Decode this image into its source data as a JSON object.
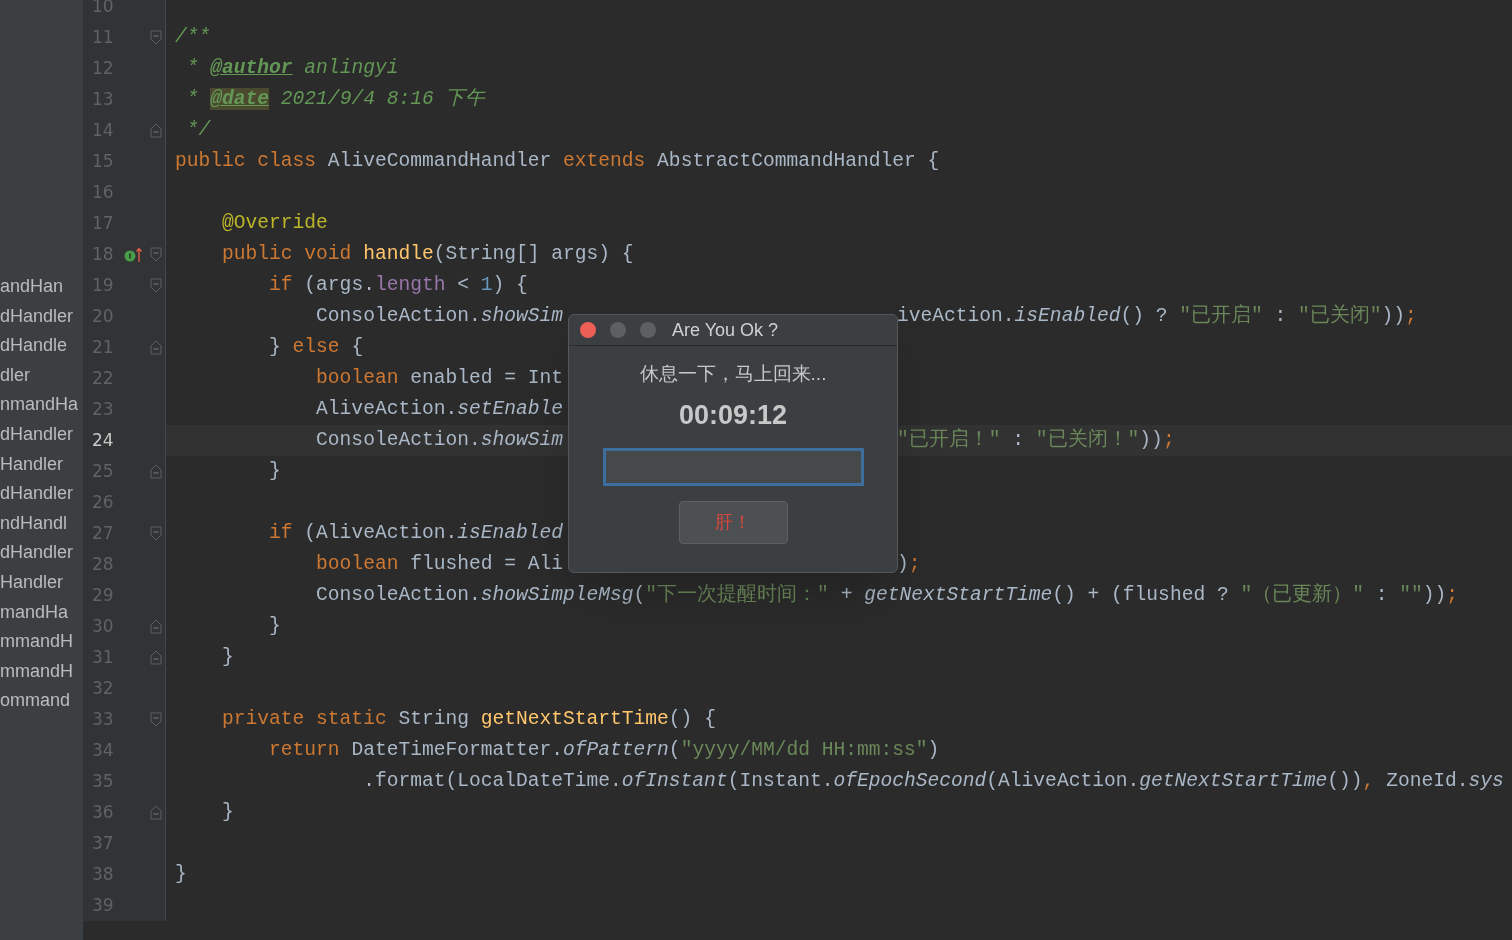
{
  "project_tree": {
    "items": [
      {
        "label": "andHan"
      },
      {
        "label": "dHandler"
      },
      {
        "label": "dHandle"
      },
      {
        "label": "dler"
      },
      {
        "label": "nmandHa"
      },
      {
        "label": "dHandler"
      },
      {
        "label": "Handler"
      },
      {
        "label": "dHandler"
      },
      {
        "label": "ndHandl"
      },
      {
        "label": "dHandler"
      },
      {
        "label": "Handler"
      },
      {
        "label": "mandHa"
      },
      {
        "label": "mmandH"
      },
      {
        "label": "mmandH"
      },
      {
        "label": "ommand"
      }
    ]
  },
  "editor": {
    "lines": [
      {
        "number": "10",
        "current": false,
        "fold_start": false,
        "fold_end": false,
        "marker": false
      },
      {
        "number": "11",
        "current": false,
        "fold_start": true,
        "fold_end": false,
        "marker": false,
        "tokens": [
          {
            "kind": "doc",
            "text": "/**"
          }
        ]
      },
      {
        "number": "12",
        "current": false,
        "fold_start": false,
        "fold_end": false,
        "marker": false,
        "tokens": [
          {
            "kind": "doc",
            "text": " * "
          },
          {
            "kind": "doctag",
            "text": "@author"
          },
          {
            "kind": "doc",
            "text": " anlingyi"
          }
        ]
      },
      {
        "number": "13",
        "current": false,
        "fold_start": false,
        "fold_end": false,
        "marker": false,
        "tokens": [
          {
            "kind": "doc",
            "text": " * "
          },
          {
            "kind": "doctag_match",
            "text": "@date"
          },
          {
            "kind": "doc",
            "text": " 2021/9/4 8:16 下午"
          }
        ]
      },
      {
        "number": "14",
        "current": false,
        "fold_start": false,
        "fold_end": true,
        "marker": false,
        "tokens": [
          {
            "kind": "doc",
            "text": " */"
          }
        ]
      },
      {
        "number": "15",
        "current": false,
        "fold_start": false,
        "fold_end": false,
        "marker": false,
        "tokens": [
          {
            "kind": "kw",
            "text": "public class "
          },
          {
            "kind": "plain",
            "text": "AliveCommandHandler "
          },
          {
            "kind": "kw",
            "text": "extends "
          },
          {
            "kind": "plain",
            "text": "AbstractCommandHandler {"
          }
        ]
      },
      {
        "number": "16",
        "current": false,
        "fold_start": false,
        "fold_end": false,
        "marker": false
      },
      {
        "number": "17",
        "current": false,
        "fold_start": false,
        "fold_end": false,
        "marker": false,
        "tokens": [
          {
            "kind": "anno",
            "text": "    @Override"
          }
        ]
      },
      {
        "number": "18",
        "current": false,
        "fold_start": true,
        "fold_end": false,
        "marker": true,
        "tokens": [
          {
            "kind": "kw",
            "text": "    public void "
          },
          {
            "kind": "decl",
            "text": "handle"
          },
          {
            "kind": "plain",
            "text": "(String[] args) {"
          }
        ]
      },
      {
        "number": "19",
        "current": false,
        "fold_start": true,
        "fold_end": false,
        "marker": false,
        "tokens": [
          {
            "kind": "kw",
            "text": "        if "
          },
          {
            "kind": "plain",
            "text": "(args."
          },
          {
            "kind": "field",
            "text": "length"
          },
          {
            "kind": "plain",
            "text": " < "
          },
          {
            "kind": "num",
            "text": "1"
          },
          {
            "kind": "plain",
            "text": ") {"
          }
        ]
      },
      {
        "number": "20",
        "current": false,
        "fold_start": false,
        "fold_end": false,
        "marker": false,
        "tokens": [
          {
            "kind": "plain",
            "text": "            ConsoleAction."
          },
          {
            "kind": "call",
            "text": "showSim"
          }
        ],
        "after": [
          {
            "kind": "plain",
            "text": "iveAction."
          },
          {
            "kind": "call",
            "text": "isEnabled"
          },
          {
            "kind": "plain",
            "text": "() ? "
          },
          {
            "kind": "str",
            "text": "\"已开启\""
          },
          {
            "kind": "plain",
            "text": " : "
          },
          {
            "kind": "str",
            "text": "\"已关闭\""
          },
          {
            "kind": "plain",
            "text": "))"
          },
          {
            "kind": "kw",
            "text": ";"
          }
        ]
      },
      {
        "number": "21",
        "current": false,
        "fold_start": false,
        "fold_end": true,
        "marker": false,
        "tokens": [
          {
            "kind": "plain",
            "text": "        } "
          },
          {
            "kind": "kw",
            "text": "else"
          },
          {
            "kind": "plain",
            "text": " {"
          }
        ]
      },
      {
        "number": "22",
        "current": false,
        "fold_start": false,
        "fold_end": false,
        "marker": false,
        "tokens": [
          {
            "kind": "kw",
            "text": "            boolean "
          },
          {
            "kind": "plain",
            "text": "enabled = Int"
          }
        ]
      },
      {
        "number": "23",
        "current": false,
        "fold_start": false,
        "fold_end": false,
        "marker": false,
        "tokens": [
          {
            "kind": "plain",
            "text": "            AliveAction."
          },
          {
            "kind": "call",
            "text": "setEnable"
          }
        ]
      },
      {
        "number": "24",
        "current": true,
        "fold_start": false,
        "fold_end": false,
        "marker": false,
        "tokens": [
          {
            "kind": "plain",
            "text": "            ConsoleAction."
          },
          {
            "kind": "call",
            "text": "showSim"
          }
        ],
        "after": [
          {
            "kind": "str",
            "text": "\"已开启！\""
          },
          {
            "kind": "plain",
            "text": " : "
          },
          {
            "kind": "str",
            "text": "\"已关闭！\""
          },
          {
            "kind": "plain",
            "text": "))"
          },
          {
            "kind": "kw",
            "text": ";"
          }
        ]
      },
      {
        "number": "25",
        "current": false,
        "fold_start": false,
        "fold_end": true,
        "marker": false,
        "tokens": [
          {
            "kind": "plain",
            "text": "        }"
          }
        ]
      },
      {
        "number": "26",
        "current": false,
        "fold_start": false,
        "fold_end": false,
        "marker": false
      },
      {
        "number": "27",
        "current": false,
        "fold_start": true,
        "fold_end": false,
        "marker": false,
        "tokens": [
          {
            "kind": "kw",
            "text": "        if "
          },
          {
            "kind": "plain",
            "text": "(AliveAction."
          },
          {
            "kind": "call",
            "text": "isEnabled"
          }
        ]
      },
      {
        "number": "28",
        "current": false,
        "fold_start": false,
        "fold_end": false,
        "marker": false,
        "tokens": [
          {
            "kind": "kw",
            "text": "            boolean "
          },
          {
            "kind": "plain",
            "text": "flushed = Ali"
          }
        ],
        "after": [
          {
            "kind": "plain",
            "text": ")"
          },
          {
            "kind": "kw",
            "text": ";"
          }
        ]
      },
      {
        "number": "29",
        "current": false,
        "fold_start": false,
        "fold_end": false,
        "marker": false,
        "tokens": [
          {
            "kind": "plain",
            "text": "            ConsoleAction."
          },
          {
            "kind": "call",
            "text": "showSimpleMsg"
          },
          {
            "kind": "plain",
            "text": "("
          },
          {
            "kind": "str",
            "text": "\"下一次提醒时间：\""
          },
          {
            "kind": "plain",
            "text": " + "
          },
          {
            "kind": "call",
            "text": "getNextStartTime"
          },
          {
            "kind": "plain",
            "text": "() + (flushed ? "
          },
          {
            "kind": "str",
            "text": "\"（已更新）\""
          },
          {
            "kind": "plain",
            "text": " : "
          },
          {
            "kind": "str",
            "text": "\"\""
          },
          {
            "kind": "plain",
            "text": "))"
          },
          {
            "kind": "kw",
            "text": ";"
          }
        ]
      },
      {
        "number": "30",
        "current": false,
        "fold_start": false,
        "fold_end": true,
        "marker": false,
        "tokens": [
          {
            "kind": "plain",
            "text": "        }"
          }
        ]
      },
      {
        "number": "31",
        "current": false,
        "fold_start": false,
        "fold_end": true,
        "marker": false,
        "tokens": [
          {
            "kind": "plain",
            "text": "    }"
          }
        ]
      },
      {
        "number": "32",
        "current": false,
        "fold_start": false,
        "fold_end": false,
        "marker": false
      },
      {
        "number": "33",
        "current": false,
        "fold_start": true,
        "fold_end": false,
        "marker": false,
        "tokens": [
          {
            "kind": "kw",
            "text": "    private static "
          },
          {
            "kind": "plain",
            "text": "String "
          },
          {
            "kind": "decl",
            "text": "getNextStartTime"
          },
          {
            "kind": "plain",
            "text": "() {"
          }
        ]
      },
      {
        "number": "34",
        "current": false,
        "fold_start": false,
        "fold_end": false,
        "marker": false,
        "tokens": [
          {
            "kind": "kw",
            "text": "        return "
          },
          {
            "kind": "plain",
            "text": "DateTimeFormatter."
          },
          {
            "kind": "call",
            "text": "ofPattern"
          },
          {
            "kind": "plain",
            "text": "("
          },
          {
            "kind": "str",
            "text": "\"yyyy/MM/dd HH:mm:ss\""
          },
          {
            "kind": "plain",
            "text": ")"
          }
        ]
      },
      {
        "number": "35",
        "current": false,
        "fold_start": false,
        "fold_end": false,
        "marker": false,
        "tokens": [
          {
            "kind": "plain",
            "text": "                .format(LocalDateTime."
          },
          {
            "kind": "call",
            "text": "ofInstant"
          },
          {
            "kind": "plain",
            "text": "(Instant."
          },
          {
            "kind": "call",
            "text": "ofEpochSecond"
          },
          {
            "kind": "plain",
            "text": "(AliveAction."
          },
          {
            "kind": "call",
            "text": "getNextStartTime"
          },
          {
            "kind": "plain",
            "text": "())"
          },
          {
            "kind": "kw",
            "text": ", "
          },
          {
            "kind": "plain",
            "text": "ZoneId."
          },
          {
            "kind": "call",
            "text": "sys"
          }
        ]
      },
      {
        "number": "36",
        "current": false,
        "fold_start": false,
        "fold_end": true,
        "marker": false,
        "tokens": [
          {
            "kind": "plain",
            "text": "    }"
          }
        ]
      },
      {
        "number": "37",
        "current": false,
        "fold_start": false,
        "fold_end": false,
        "marker": false
      },
      {
        "number": "38",
        "current": false,
        "fold_start": false,
        "fold_end": false,
        "marker": false,
        "tokens": [
          {
            "kind": "plain",
            "text": "}"
          }
        ]
      },
      {
        "number": "39",
        "current": false,
        "fold_start": false,
        "fold_end": false,
        "marker": false
      }
    ]
  },
  "dialog": {
    "title": "Are You Ok ?",
    "message": "休息一下，马上回来...",
    "timer": "00:09:12",
    "input": {
      "focused": true
    },
    "button": "肝！"
  }
}
